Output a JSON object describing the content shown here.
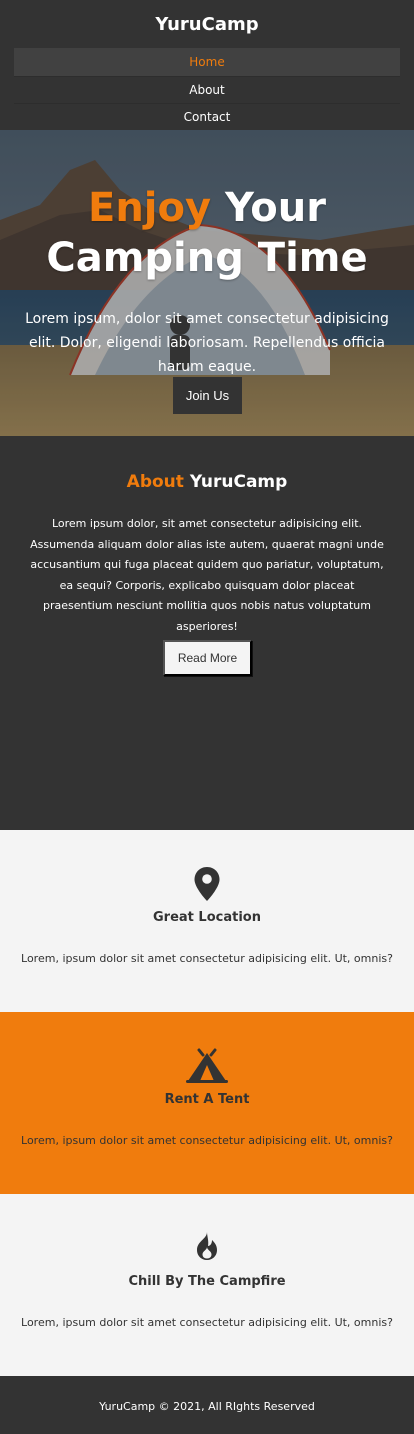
{
  "header": {
    "brand": "YuruCamp",
    "nav": [
      "Home",
      "About",
      "Contact"
    ]
  },
  "hero": {
    "title_accent": "Enjoy",
    "title_rest_line1": " Your",
    "title_line2": "Camping Time",
    "text": "Lorem ipsum, dolor sit amet consectetur adipisicing elit. Dolor, eligendi laboriosam. Repellendus officia harum eaque.",
    "button_label": "Join Us"
  },
  "about": {
    "title_accent": "About",
    "title_rest": " YuruCamp",
    "text": "Lorem ipsum dolor, sit amet consectetur adipisicing elit. Assumenda aliquam dolor alias iste autem, quaerat magni unde accusantium qui fuga placeat quidem quo pariatur, voluptatum, ea sequi? Corporis, explicabo quisquam dolor placeat praesentium nesciunt mollitia quos nobis natus voluptatum asperiores!",
    "button_label": "Read More"
  },
  "features": [
    {
      "icon": "map-pin-icon",
      "title": "Great Location",
      "text": "Lorem, ipsum dolor sit amet consectetur adipisicing elit. Ut, omnis?"
    },
    {
      "icon": "tent-icon",
      "title": "Rent A Tent",
      "text": "Lorem, ipsum dolor sit amet consectetur adipisicing elit. Ut, omnis?"
    },
    {
      "icon": "fire-icon",
      "title": "Chill By The Campfire",
      "text": "Lorem, ipsum dolor sit amet consectetur adipisicing elit. Ut, omnis?"
    }
  ],
  "footer": {
    "text": "YuruCamp © 2021, All RIghts Reserved"
  },
  "colors": {
    "accent": "#f07c0d",
    "dark": "#333333",
    "light": "#f4f4f4"
  }
}
